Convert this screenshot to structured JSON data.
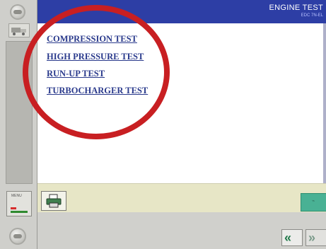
{
  "header": {
    "title": "ENGINE TEST",
    "subtitle": "EDC 7N-EL"
  },
  "tests": [
    "COMPRESSION TEST",
    "HIGH PRESSURE TEST",
    "RUN-UP TEST",
    "TURBOCHARGER TEST"
  ],
  "sidebar": {
    "tool_label": "MENU"
  },
  "footer": {
    "back_glyph": "«",
    "forward_glyph": "»"
  },
  "colors": {
    "header": "#2d3ea5",
    "link": "#2a3a8c",
    "annotation": "#c81f22",
    "confirm": "#49b194"
  }
}
